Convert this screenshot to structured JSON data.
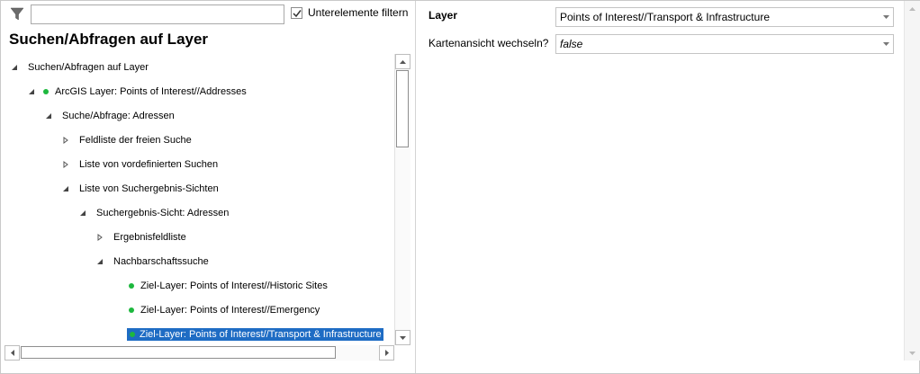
{
  "filter": {
    "input_value": "",
    "icon": "filter-icon",
    "subfilter_checked": true,
    "subfilter_label": "Unterelemente filtern"
  },
  "panel_title": "Suchen/Abfragen auf Layer",
  "tree": [
    {
      "label": "Suchen/Abfragen auf Layer",
      "toggle": "expanded",
      "dot": false
    },
    {
      "label": "ArcGIS Layer: Points of Interest//Addresses",
      "toggle": "expanded",
      "dot": true
    },
    {
      "label": "Suche/Abfrage: Adressen",
      "toggle": "expanded",
      "dot": false
    },
    {
      "label": "Feldliste der freien Suche",
      "toggle": "collapsed",
      "dot": false
    },
    {
      "label": "Liste von vordefinierten Suchen",
      "toggle": "collapsed",
      "dot": false
    },
    {
      "label": "Liste von Suchergebnis-Sichten",
      "toggle": "expanded",
      "dot": false
    },
    {
      "label": "Suchergebnis-Sicht: Adressen",
      "toggle": "expanded",
      "dot": false
    },
    {
      "label": "Ergebnisfeldliste",
      "toggle": "collapsed",
      "dot": false
    },
    {
      "label": "Nachbarschaftssuche",
      "toggle": "expanded",
      "dot": false
    },
    {
      "label": "Ziel-Layer: Points of Interest//Historic Sites",
      "toggle": "none",
      "dot": true
    },
    {
      "label": "Ziel-Layer: Points of Interest//Emergency",
      "toggle": "none",
      "dot": true
    },
    {
      "label": "Ziel-Layer: Points of Interest//Transport & Infrastructure",
      "toggle": "none",
      "dot": true,
      "selected": true
    }
  ],
  "properties": [
    {
      "label": "Layer",
      "bold": true,
      "value": "Points of Interest//Transport & Infrastructure",
      "italic": false
    },
    {
      "label": "Kartenansicht wechseln?",
      "bold": false,
      "value": "false",
      "italic": true
    }
  ],
  "colors": {
    "selection": "#1e6cc4",
    "status_dot": "#1db83e"
  }
}
